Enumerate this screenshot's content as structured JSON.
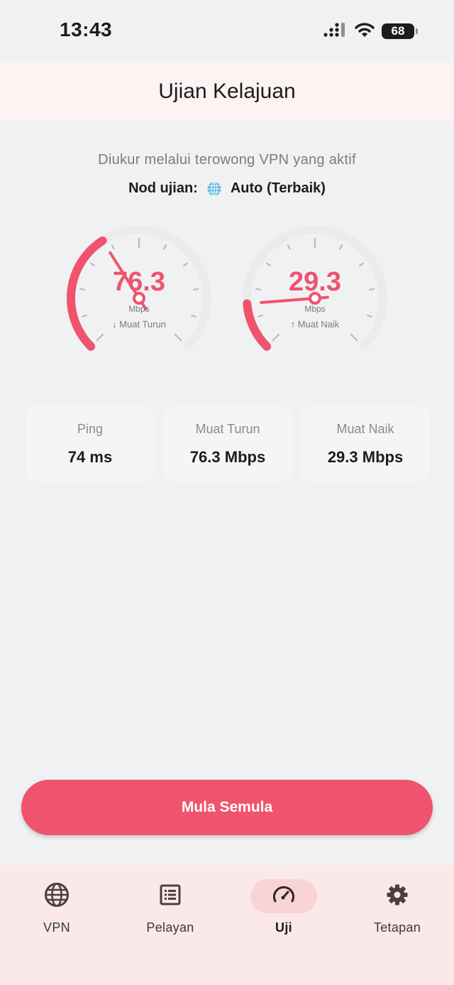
{
  "status_bar": {
    "time": "13:43",
    "battery": "68"
  },
  "header": {
    "title": "Ujian Kelajuan"
  },
  "info": {
    "subtitle": "Diukur melalui terowong VPN yang aktif",
    "node_label": "Nod ujian:",
    "node_value": "Auto (Terbaik)"
  },
  "gauges": {
    "download": {
      "value": "76.3",
      "unit": "Mbps",
      "label": "↓ Muat Turun",
      "fraction": 0.38
    },
    "upload": {
      "value": "29.3",
      "unit": "Mbps",
      "label": "↑ Muat Naik",
      "fraction": 0.15
    }
  },
  "stats": [
    {
      "label": "Ping",
      "value": "74 ms"
    },
    {
      "label": "Muat Turun",
      "value": "76.3 Mbps"
    },
    {
      "label": "Muat Naik",
      "value": "29.3 Mbps"
    }
  ],
  "actions": {
    "restart_label": "Mula Semula"
  },
  "nav": [
    {
      "label": "VPN",
      "icon": "globe-icon",
      "active": false
    },
    {
      "label": "Pelayan",
      "icon": "server-list-icon",
      "active": false
    },
    {
      "label": "Uji",
      "icon": "speedometer-icon",
      "active": true
    },
    {
      "label": "Tetapan",
      "icon": "gear-icon",
      "active": false
    }
  ],
  "colors": {
    "accent": "#ef536d",
    "track": "#ebebeb",
    "header_bg": "#fdf3f2",
    "nav_bg": "#fbe8e8"
  }
}
